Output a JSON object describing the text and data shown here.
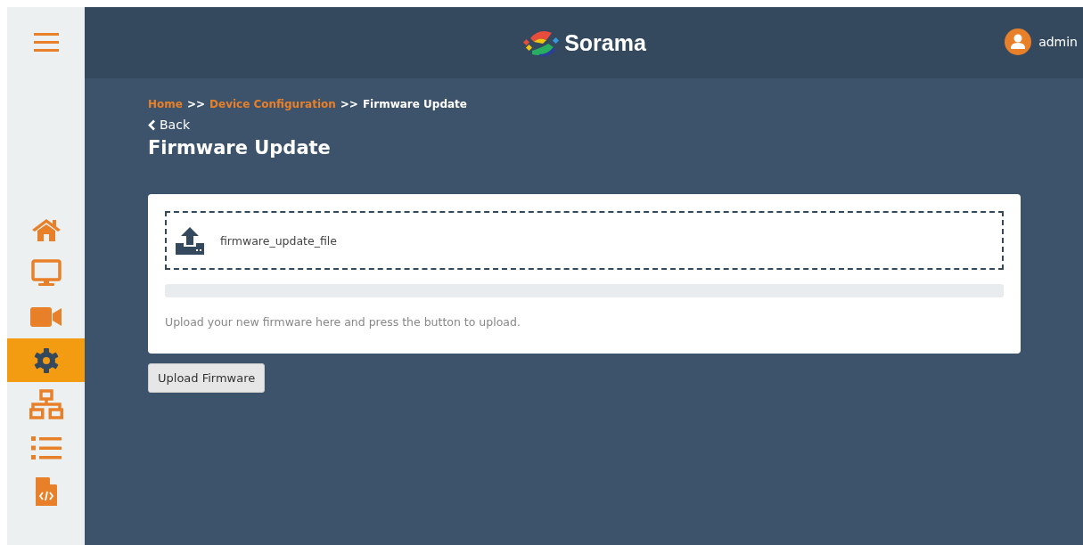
{
  "header": {
    "brand": "Sorama",
    "user": "admin"
  },
  "sidebar": {
    "items": [
      {
        "kind": "home",
        "selected": false
      },
      {
        "kind": "monitor",
        "selected": false
      },
      {
        "kind": "video",
        "selected": false
      },
      {
        "kind": "settings",
        "selected": true
      },
      {
        "kind": "network",
        "selected": false
      },
      {
        "kind": "list",
        "selected": false
      },
      {
        "kind": "code-file",
        "selected": false
      }
    ]
  },
  "breadcrumb": [
    {
      "label": "Home",
      "link": true
    },
    {
      "label": ">>",
      "link": false
    },
    {
      "label": "Device Configuration",
      "link": true
    },
    {
      "label": ">>",
      "link": false
    },
    {
      "label": "Firmware Update",
      "link": false
    }
  ],
  "back": "Back",
  "title": "Firmware Update",
  "upload": {
    "file_name": "firmware_update_file",
    "progress": {
      "level": 0
    },
    "hint": "Upload your new firmware here and press the button to upload."
  },
  "button": "Upload Firmware"
}
